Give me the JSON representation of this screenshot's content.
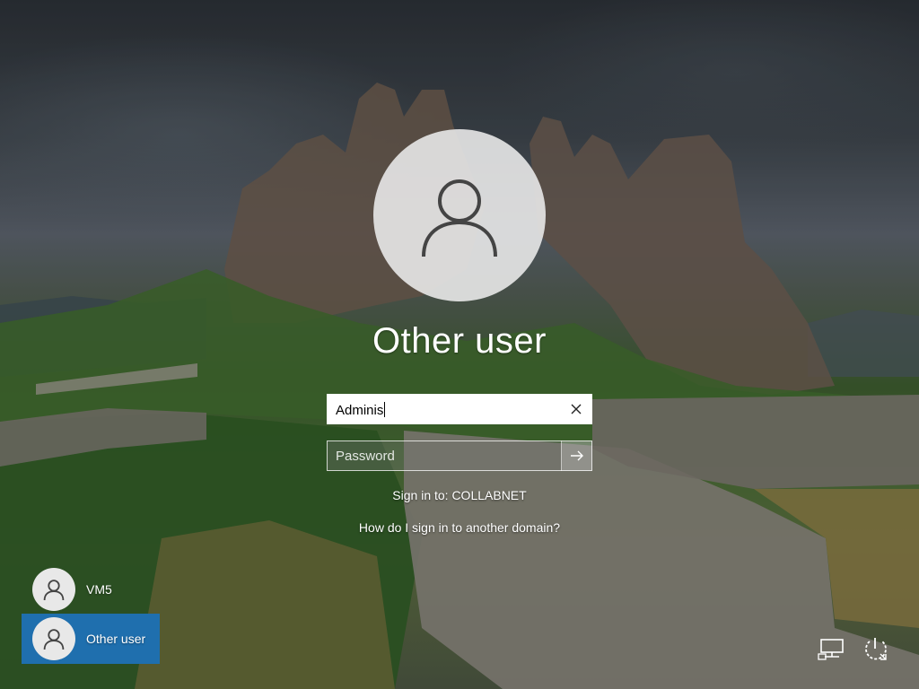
{
  "login": {
    "title": "Other user",
    "username_value": "Adminis",
    "password_placeholder": "Password",
    "signin_to": "Sign in to: COLLABNET",
    "domain_help_link": "How do I sign in to another domain?"
  },
  "user_list": [
    {
      "label": "VM5",
      "selected": false
    },
    {
      "label": "Other user",
      "selected": true
    }
  ],
  "icons": {
    "avatar": "user-icon",
    "clear": "clear-x-icon",
    "submit": "arrow-right-icon",
    "network": "network-icon",
    "power": "power-icon"
  },
  "colors": {
    "selected_tile": "#1f6fae",
    "text": "#ffffff"
  }
}
